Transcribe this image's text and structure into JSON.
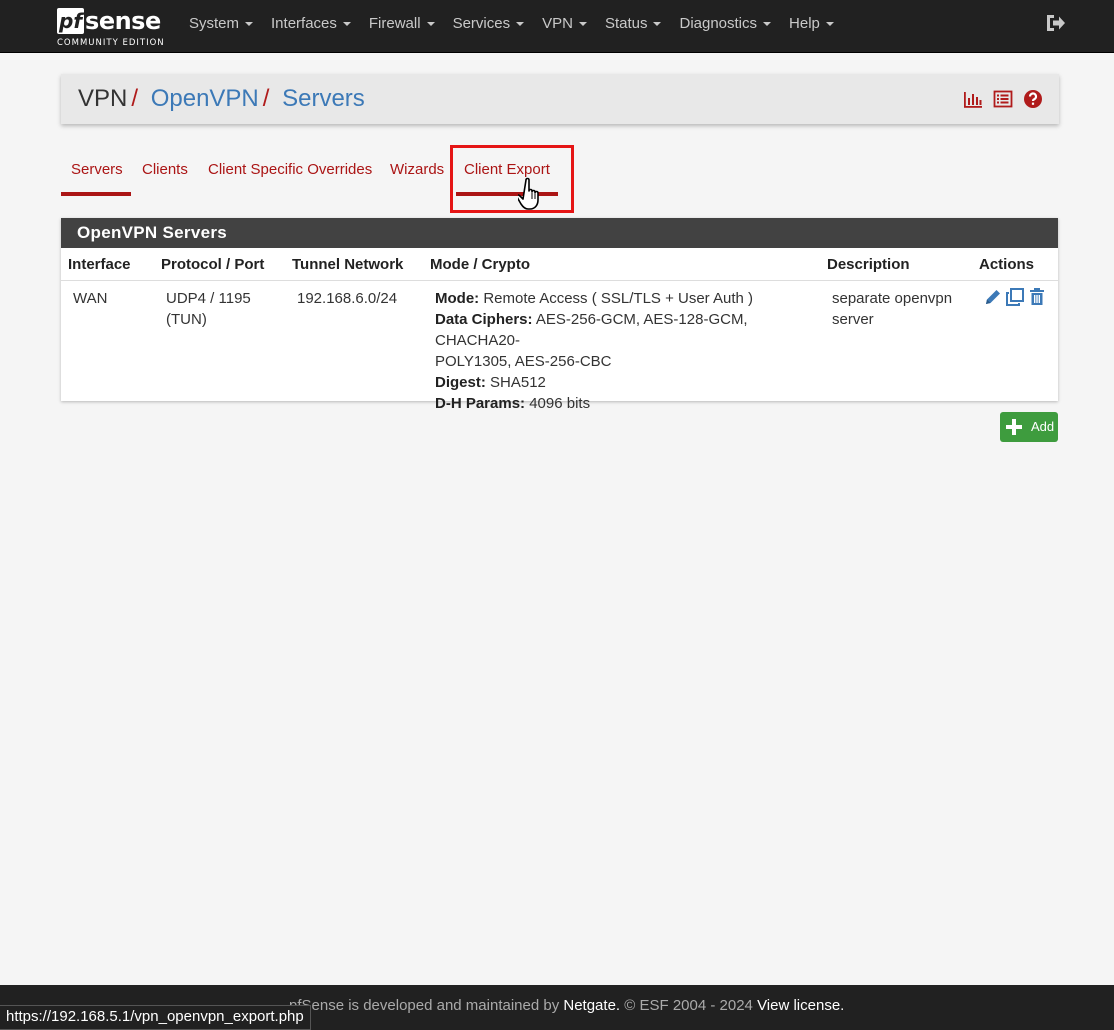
{
  "brand": {
    "pf": "pf",
    "sense": "sense",
    "edition": "COMMUNITY EDITION"
  },
  "nav": {
    "items": [
      "System",
      "Interfaces",
      "Firewall",
      "Services",
      "VPN",
      "Status",
      "Diagnostics",
      "Help"
    ],
    "logout_icon": "sign-out-icon"
  },
  "breadcrumb": {
    "root": "VPN",
    "middle": "OpenVPN",
    "current": "Servers",
    "separator": "/"
  },
  "header_icons": [
    "bar-chart-icon",
    "list-icon",
    "question-circle-icon"
  ],
  "tabs": [
    {
      "label": "Servers",
      "active": true
    },
    {
      "label": "Clients",
      "active": false
    },
    {
      "label": "Client Specific Overrides",
      "active": false
    },
    {
      "label": "Wizards",
      "active": false
    },
    {
      "label": "Client Export",
      "active": false,
      "highlighted": true
    }
  ],
  "panel": {
    "title": "OpenVPN Servers",
    "columns": [
      "Interface",
      "Protocol / Port",
      "Tunnel Network",
      "Mode / Crypto",
      "Description",
      "Actions"
    ],
    "rows": [
      {
        "interface": "WAN",
        "protocol_line1": "UDP4 / 1195",
        "protocol_line2": "(TUN)",
        "tunnel_network": "192.168.6.0/24",
        "mode_label": "Mode:",
        "mode_value": "Remote Access ( SSL/TLS + User Auth )",
        "ciphers_label": "Data Ciphers:",
        "ciphers_value_line1": "AES-256-GCM, AES-128-GCM, CHACHA20-",
        "ciphers_value_line2": "POLY1305, AES-256-CBC",
        "digest_label": "Digest:",
        "digest_value": "SHA512",
        "dh_label": "D-H Params:",
        "dh_value": "4096 bits",
        "description_line1": "separate openvpn",
        "description_line2": "server",
        "actions": [
          "pencil-icon",
          "clone-icon",
          "trash-icon"
        ]
      }
    ]
  },
  "add_button": {
    "label": "Add",
    "icon": "plus-icon"
  },
  "footer": {
    "part1": "pfSense",
    "part2": " is developed and maintained by ",
    "netgate": "Netgate.",
    "part3": " © ESF 2004 - 2024 ",
    "license": "View license."
  },
  "status_bar": {
    "url": "https://192.168.5.1/vpn_openvpn_export.php"
  },
  "colors": {
    "navbar": "#212121",
    "accent_red": "#ab1515",
    "link_blue": "#3c79b7",
    "panel_heading": "#424242",
    "add_green": "#3e9c3e",
    "highlight_red": "#e51515"
  }
}
